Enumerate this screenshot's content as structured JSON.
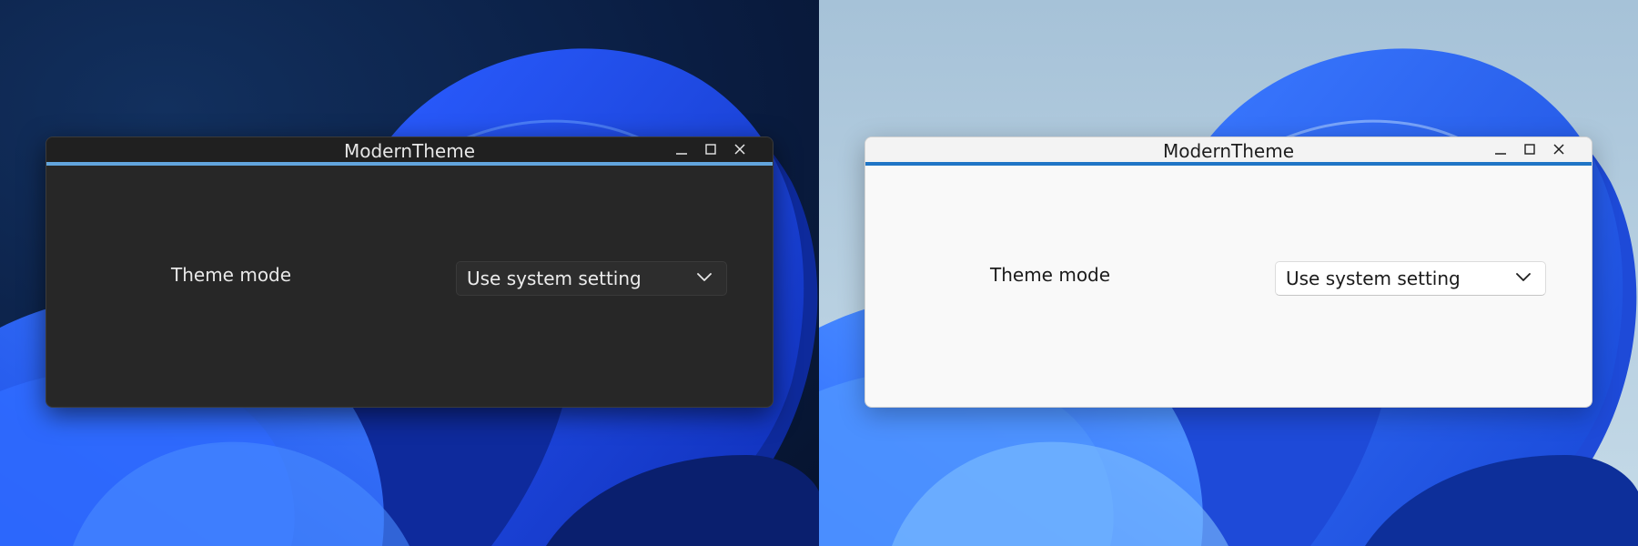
{
  "panels": [
    {
      "theme": "dark",
      "window_title": "ModernTheme",
      "setting_label": "Theme mode",
      "combo_value": "Use system setting",
      "accent_color": "#62a5dd"
    },
    {
      "theme": "light",
      "window_title": "ModernTheme",
      "setting_label": "Theme mode",
      "combo_value": "Use system setting",
      "accent_color": "#1f75c6"
    }
  ],
  "icons": {
    "minimize": "minimize-icon",
    "maximize": "maximize-icon",
    "close": "close-icon",
    "dropdown": "chevron-down-icon"
  }
}
